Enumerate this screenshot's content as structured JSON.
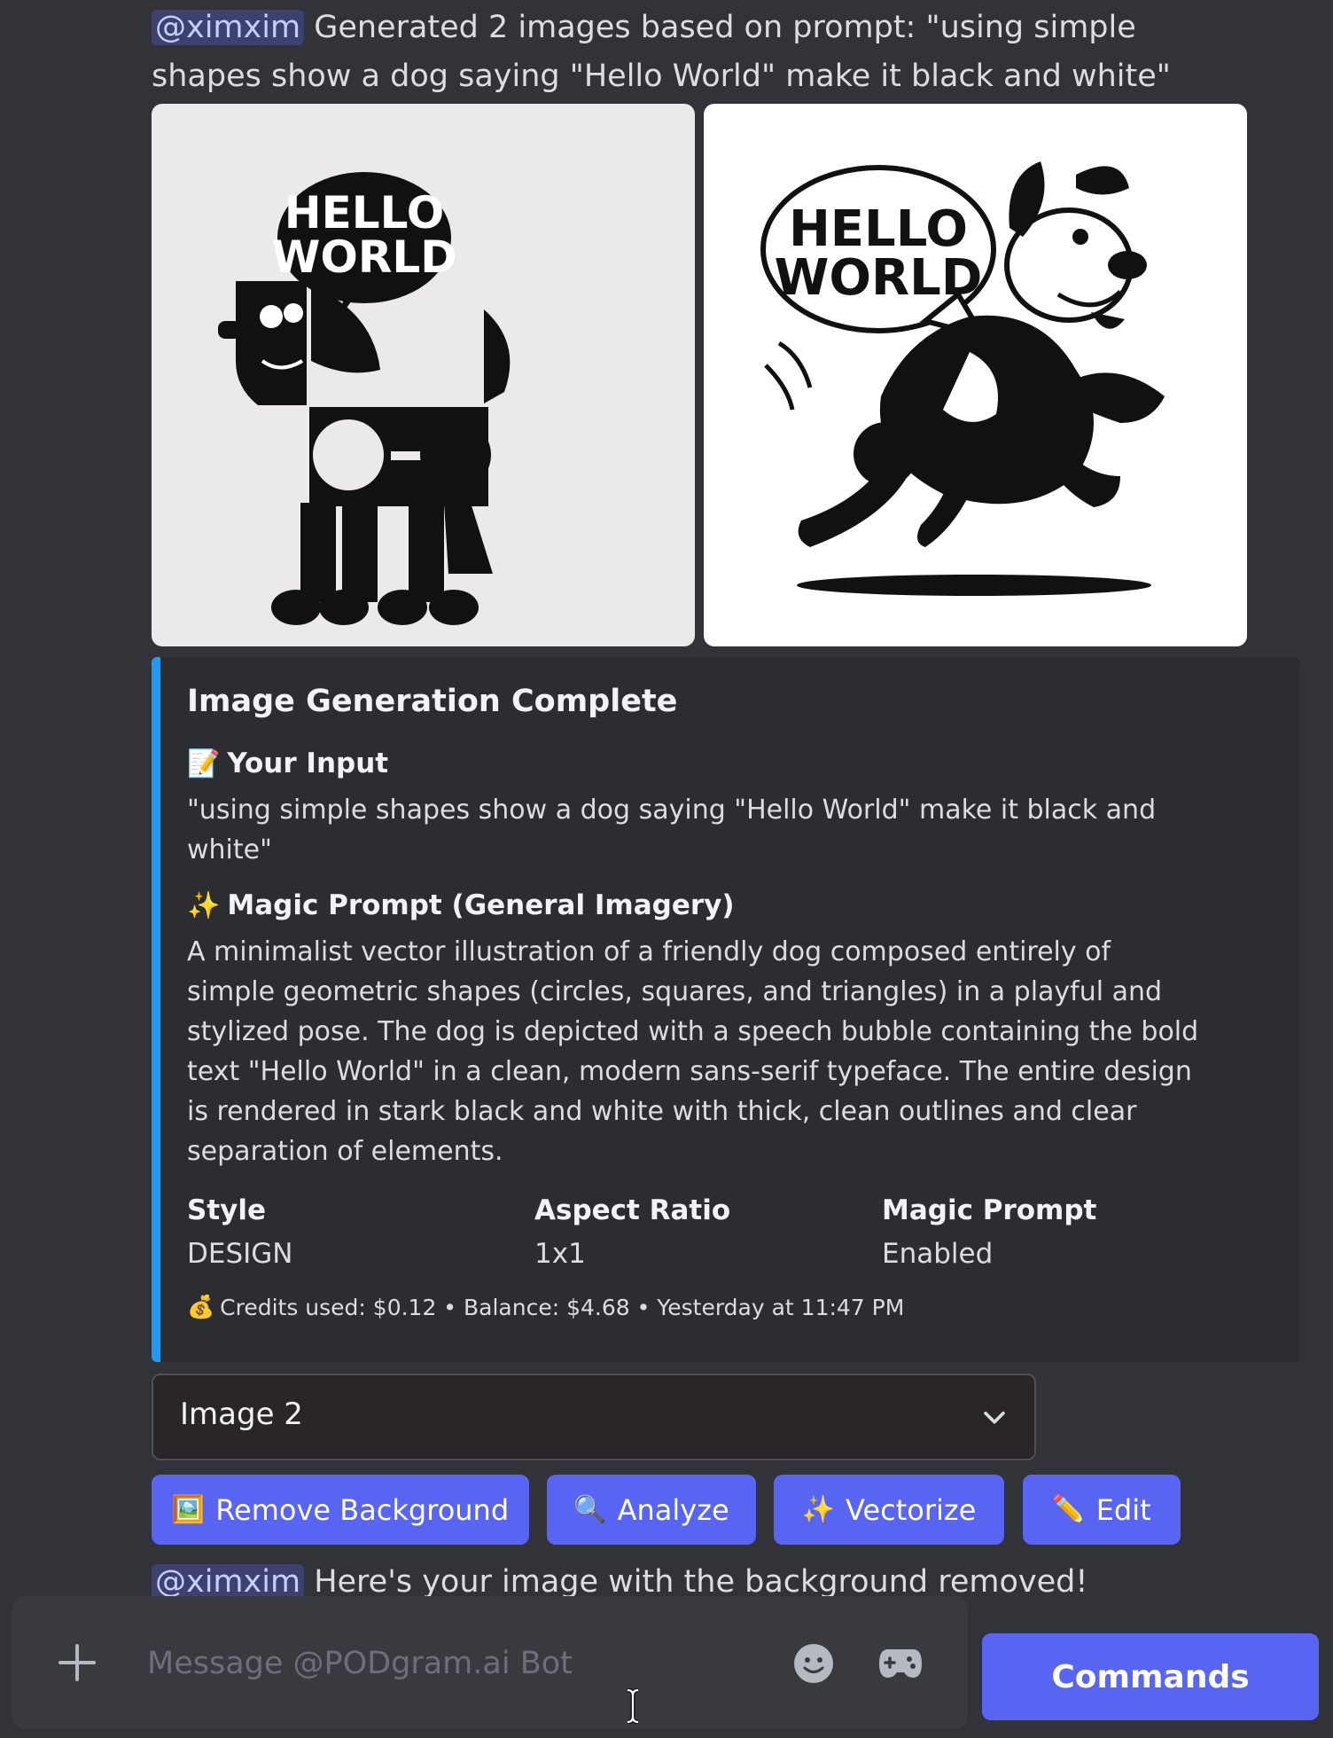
{
  "message": {
    "mention": "@ximxim",
    "text": "Generated 2 images based on prompt: \"using simple shapes show a dog saying \"Hello World\" make it black and white\""
  },
  "images": [
    {
      "alt": "HELLO WORLD",
      "bubble_line1": "HELLO",
      "bubble_line2": "WORLD"
    },
    {
      "alt": "HELLO WORLD",
      "bubble_line1": "HELLO",
      "bubble_line2": "WORLD"
    }
  ],
  "embed": {
    "accent_color": "#1e9bf0",
    "title": "Image Generation Complete",
    "your_input": {
      "icon": "memo-icon",
      "icon_glyph": "📝",
      "label": "Your Input",
      "value": "\"using simple shapes show a dog saying \"Hello World\" make it black and white\""
    },
    "magic_prompt": {
      "icon": "sparkles-icon",
      "icon_glyph": "✨",
      "label": "Magic Prompt (General Imagery)",
      "value": "A minimalist vector illustration of a friendly dog composed entirely of simple geometric shapes (circles, squares, and triangles) in a playful and stylized pose. The dog is depicted with a speech bubble containing the bold text \"Hello World\" in a clean, modern sans-serif typeface. The entire design is rendered in stark black and white with thick, clean outlines and clear separation of elements."
    },
    "fields": [
      {
        "name": "Style",
        "value": "DESIGN"
      },
      {
        "name": "Aspect Ratio",
        "value": "1x1"
      },
      {
        "name": "Magic Prompt",
        "value": "Enabled"
      }
    ],
    "footer": {
      "icon_glyph": "💰",
      "text": "Credits used: $0.12 • Balance: $4.68 • Yesterday at 11:47 PM"
    }
  },
  "dropdown": {
    "selected": "Image 2"
  },
  "buttons": [
    {
      "emoji": "🖼️",
      "label": "Remove Background"
    },
    {
      "emoji": "🔍",
      "label": "Analyze"
    },
    {
      "emoji": "✨",
      "label": "Vectorize"
    },
    {
      "emoji": "✏️",
      "label": "Edit"
    }
  ],
  "next_message": {
    "mention": "@ximxim",
    "text": "Here's your image with the background removed!"
  },
  "composer": {
    "placeholder": "Message @PODgram.ai Bot",
    "commands_label": "Commands"
  },
  "colors": {
    "background": "#313338",
    "embed_bg": "#2b2d31",
    "blurple": "#5865f2"
  }
}
